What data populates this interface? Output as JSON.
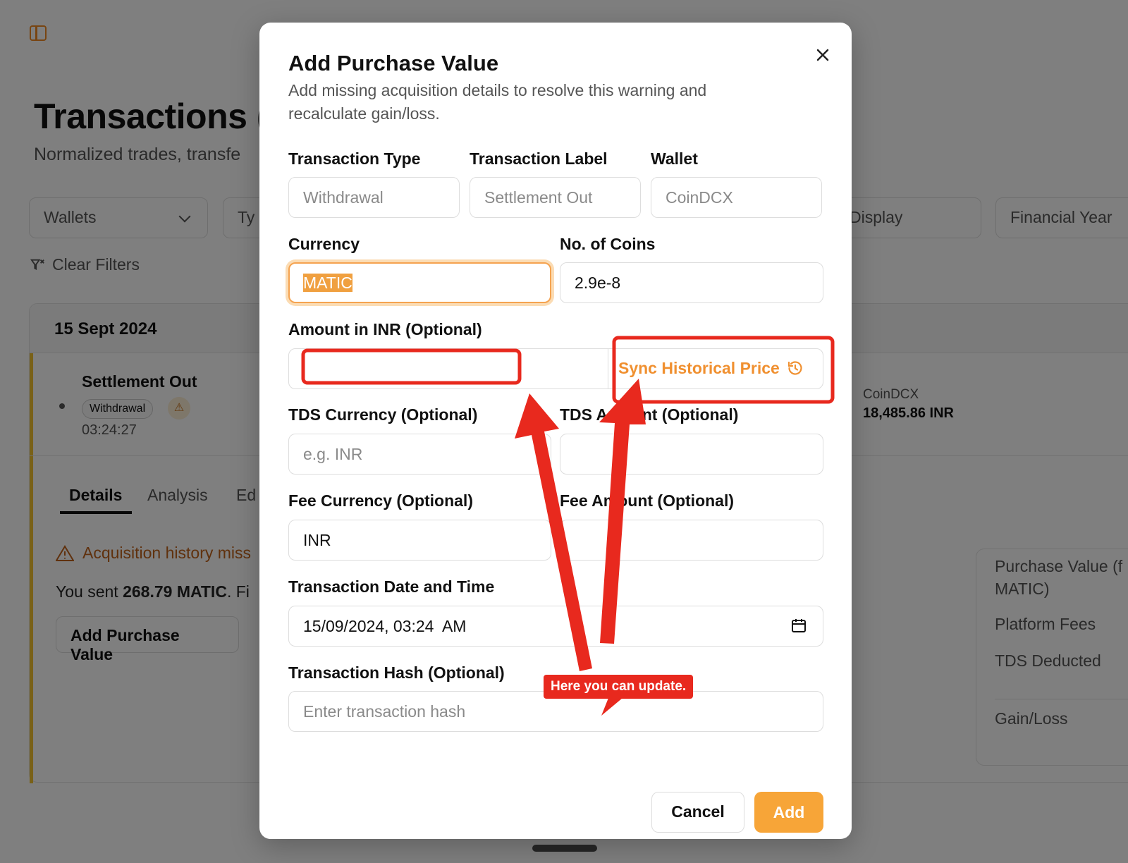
{
  "background": {
    "page_title": "Transactions (",
    "page_subtitle": "Normalized trades, transfe",
    "filters": {
      "wallets": "Wallets",
      "type": "Ty",
      "display": "Display",
      "financial_year": "Financial Year"
    },
    "clear_filters": "Clear Filters",
    "date": "15 Sept 2024",
    "transaction": {
      "title": "Settlement Out",
      "badge": "Withdrawal",
      "warning_glyph": "⚠",
      "time": "03:24:27",
      "wallet": "CoinDCX",
      "amount": "18,485.86 INR"
    },
    "tabs": [
      "Details",
      "Analysis",
      "Ed"
    ],
    "warning": "Acquisition history miss",
    "sent_prefix": "You sent ",
    "sent_amount": "268.79 MATIC",
    "sent_suffix": ". Fi",
    "add_purchase_button": "Add Purchase Value",
    "summary": {
      "purchase_value": "Purchase Value (f MATIC)",
      "platform_fees": "Platform Fees",
      "tds_deducted": "TDS Deducted",
      "gain_loss": "Gain/Loss"
    }
  },
  "modal": {
    "title": "Add Purchase Value",
    "description": "Add missing acquisition details to resolve this warning and recalculate gain/loss.",
    "labels": {
      "transaction_type": "Transaction Type",
      "transaction_label": "Transaction Label",
      "wallet": "Wallet",
      "currency": "Currency",
      "no_of_coins": "No. of Coins",
      "amount_inr": "Amount in INR (Optional)",
      "tds_currency": "TDS Currency (Optional)",
      "tds_amount": "TDS Amount (Optional)",
      "fee_currency": "Fee Currency (Optional)",
      "fee_amount": "Fee Amount (Optional)",
      "date_time": "Transaction Date and Time",
      "tx_hash": "Transaction Hash (Optional)"
    },
    "values": {
      "transaction_type": "Withdrawal",
      "transaction_label": "Settlement Out",
      "wallet": "CoinDCX",
      "currency": "MATIC",
      "no_of_coins": "2.9e-8",
      "amount_inr": "",
      "tds_amount": "",
      "fee_currency": "INR",
      "fee_amount": "",
      "date_time": "15/09/2024, 03:24  AM",
      "tx_hash": ""
    },
    "placeholders": {
      "tds_currency": "e.g. INR",
      "tx_hash": "Enter transaction hash"
    },
    "sync_button": "Sync Historical Price",
    "cancel_button": "Cancel",
    "add_button": "Add"
  },
  "annotation": {
    "callout": "Here you can update."
  },
  "colors": {
    "accent": "#f7a538",
    "annotation_red": "#e8291e",
    "warning": "#c0621a"
  }
}
